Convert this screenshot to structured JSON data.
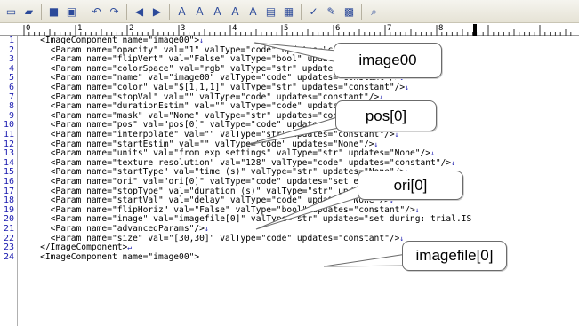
{
  "toolbar": {
    "buttons": [
      {
        "name": "new-file-icon",
        "glyph": "▭"
      },
      {
        "name": "open-folder-icon",
        "glyph": "▰"
      },
      {
        "name": "save-icon",
        "glyph": "■"
      },
      {
        "name": "save-all-icon",
        "glyph": "▣"
      },
      {
        "name": "undo-icon",
        "glyph": "↶"
      },
      {
        "name": "redo-icon",
        "glyph": "↷"
      },
      {
        "name": "back-icon",
        "glyph": "◀"
      },
      {
        "name": "forward-icon",
        "glyph": "▶"
      },
      {
        "name": "find-icon",
        "glyph": "A"
      },
      {
        "name": "find-next-icon",
        "glyph": "A"
      },
      {
        "name": "find-prev-icon",
        "glyph": "A"
      },
      {
        "name": "replace-icon",
        "glyph": "A"
      },
      {
        "name": "highlight-icon",
        "glyph": "A"
      },
      {
        "name": "grep-icon",
        "glyph": "▤"
      },
      {
        "name": "outline-icon",
        "glyph": "▦"
      },
      {
        "name": "compare-icon",
        "glyph": "✓"
      },
      {
        "name": "edit-mode-icon",
        "glyph": "✎"
      },
      {
        "name": "settings-icon",
        "glyph": "▩"
      },
      {
        "name": "search-window-icon",
        "glyph": "⌕"
      }
    ]
  },
  "ruler": {
    "numbers": [
      "0",
      "1",
      "2",
      "3",
      "4",
      "5",
      "6",
      "7",
      "8"
    ]
  },
  "code_lines": [
    {
      "num": "1",
      "text": "    <ImageComponent name=\"image00\">"
    },
    {
      "num": "2",
      "text": "      <Param name=\"opacity\" val=\"1\" valType=\"code\" updates=\"constant\"/>"
    },
    {
      "num": "3",
      "text": "      <Param name=\"flipVert\" val=\"False\" valType=\"bool\" updates=\"constant\"/>"
    },
    {
      "num": "4",
      "text": "      <Param name=\"colorSpace\" val=\"rgb\" valType=\"str\" updates=\"constant\"/>"
    },
    {
      "num": "5",
      "text": "      <Param name=\"name\" val=\"image00\" valType=\"code\" updates=\"constant\"/>"
    },
    {
      "num": "6",
      "text": "      <Param name=\"color\" val=\"$[1,1,1]\" valType=\"str\" updates=\"constant\"/>"
    },
    {
      "num": "7",
      "text": "      <Param name=\"stopVal\" val=\"\" valType=\"code\" updates=\"constant\"/>"
    },
    {
      "num": "8",
      "text": "      <Param name=\"durationEstim\" val=\"\" valType=\"code\" updates=\"None\"/>"
    },
    {
      "num": "9",
      "text": "      <Param name=\"mask\" val=\"None\" valType=\"str\" updates=\"constant\"/>"
    },
    {
      "num": "10",
      "text": "      <Param name=\"pos\" val=\"pos[0]\" valType=\"code\" updates=\"set every repeat\"/>"
    },
    {
      "num": "11",
      "text": "      <Param name=\"interpolate\" val=\"\" valType=\"str\" updates=\"constant\"/>"
    },
    {
      "num": "12",
      "text": "      <Param name=\"startEstim\" val=\"\" valType=\"code\" updates=\"None\"/>"
    },
    {
      "num": "13",
      "text": "      <Param name=\"units\" val=\"from exp settings\" valType=\"str\" updates=\"None\"/>"
    },
    {
      "num": "14",
      "text": "      <Param name=\"texture resolution\" val=\"128\" valType=\"code\" updates=\"constant\"/>"
    },
    {
      "num": "15",
      "text": "      <Param name=\"startType\" val=\"time (s)\" valType=\"str\" updates=\"None\"/>"
    },
    {
      "num": "16",
      "text": "      <Param name=\"ori\" val=\"ori[0]\" valType=\"code\" updates=\"set every repeat\"/>"
    },
    {
      "num": "17",
      "text": "      <Param name=\"stopType\" val=\"duration (s)\" valType=\"str\" updates=\"None\"/>"
    },
    {
      "num": "18",
      "text": "      <Param name=\"startVal\" val=\"delay\" valType=\"code\" updates=\"None\"/>"
    },
    {
      "num": "19",
      "text": "      <Param name=\"flipHoriz\" val=\"False\" valType=\"bool\" updates=\"constant\"/>"
    },
    {
      "num": "20",
      "text": "      <Param name=\"image\" val=\"imagefile[0]\" valType=\"str\" updates=\"set during: trial.IS"
    },
    {
      "num": "21",
      "text": "      <Param name=\"advancedParams\"/>"
    },
    {
      "num": "22",
      "text": "      <Param name=\"size\" val=\"[30,30]\" valType=\"code\" updates=\"constant\"/>"
    },
    {
      "num": "23",
      "text": "    </ImageComponent>"
    },
    {
      "num": "24",
      "text": "    <ImageComponent name=\"image00\">"
    }
  ],
  "eol_marker": "↓",
  "eol_marker_last": "↵",
  "callouts": [
    {
      "label": "image00"
    },
    {
      "label": "pos[0]"
    },
    {
      "label": "ori[0]"
    },
    {
      "label": "imagefile[0]"
    }
  ],
  "colors": {
    "line_number": "#1c1cb0",
    "toolbar_bg": "#ece9d8",
    "callout_border": "#6b6b6b"
  }
}
